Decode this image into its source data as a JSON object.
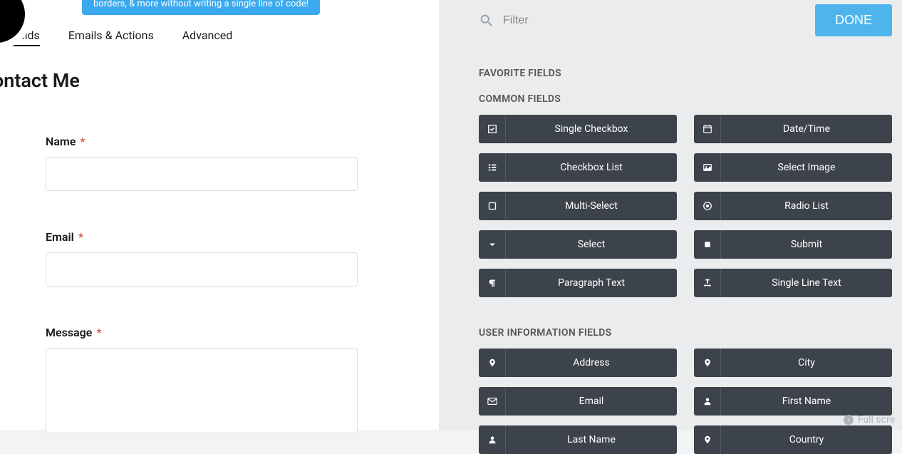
{
  "banner_text": "borders, & more without writing a single line of code!",
  "tabs": {
    "form_fields": "rm Fields",
    "emails_actions": "Emails & Actions",
    "advanced": "Advanced"
  },
  "form_title": "ontact Me",
  "form_fields": {
    "name": {
      "label": "Name",
      "required": "*"
    },
    "email": {
      "label": "Email",
      "required": "*"
    },
    "message": {
      "label": "Message",
      "required": "*"
    }
  },
  "filter_placeholder": "Filter",
  "done_label": "DONE",
  "sections": {
    "favorite": "FAVORITE FIELDS",
    "common": "COMMON FIELDS",
    "user_info": "USER INFORMATION FIELDS"
  },
  "common_fields": {
    "single_checkbox": "Single Checkbox",
    "date_time": "Date/Time",
    "checkbox_list": "Checkbox List",
    "select_image": "Select Image",
    "multi_select": "Multi-Select",
    "radio_list": "Radio List",
    "select": "Select",
    "submit": "Submit",
    "paragraph_text": "Paragraph Text",
    "single_line_text": "Single Line Text"
  },
  "user_info_fields": {
    "address": "Address",
    "city": "City",
    "email": "Email",
    "first_name": "First Name",
    "last_name": "Last Name",
    "country": "Country"
  },
  "fullscreen_label": "Full scre"
}
